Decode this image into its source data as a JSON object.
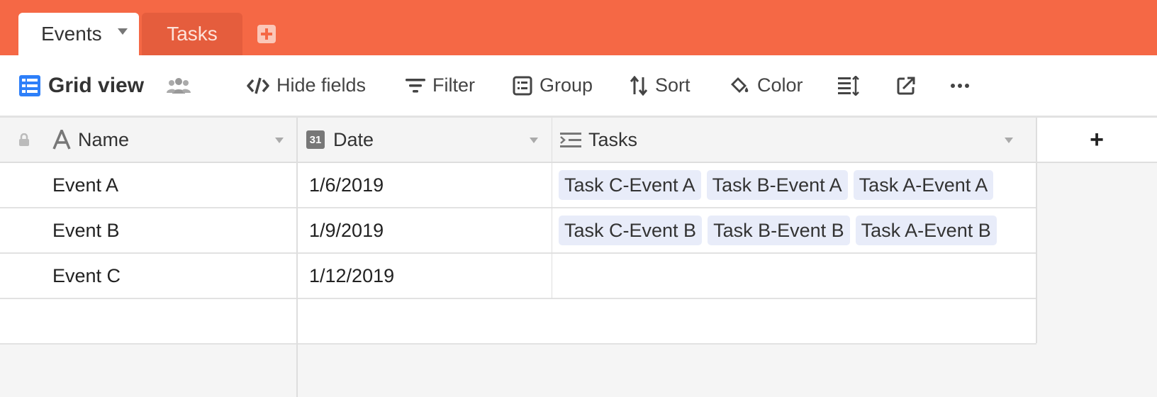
{
  "tabs": [
    {
      "label": "Events",
      "active": true
    },
    {
      "label": "Tasks",
      "active": false
    }
  ],
  "toolbar": {
    "view_name": "Grid view",
    "hide_fields": "Hide fields",
    "filter": "Filter",
    "group": "Group",
    "sort": "Sort",
    "color": "Color"
  },
  "columns": [
    {
      "label": "Name",
      "icon": "text-field-icon"
    },
    {
      "label": "Date",
      "icon": "calendar-31-icon"
    },
    {
      "label": "Tasks",
      "icon": "linked-records-icon"
    }
  ],
  "add_column_label": "+",
  "rows": [
    {
      "name": "Event A",
      "date": "1/6/2019",
      "tasks": [
        "Task C-Event A",
        "Task B-Event A",
        "Task A-Event A"
      ]
    },
    {
      "name": "Event B",
      "date": "1/9/2019",
      "tasks": [
        "Task C-Event B",
        "Task B-Event B",
        "Task A-Event B"
      ]
    },
    {
      "name": "Event C",
      "date": "1/12/2019",
      "tasks": []
    }
  ],
  "date_icon_label": "31",
  "colors": {
    "tabbar": "#f56845",
    "accent_blue": "#2d7ff9",
    "chip": "#e8ecf9"
  }
}
